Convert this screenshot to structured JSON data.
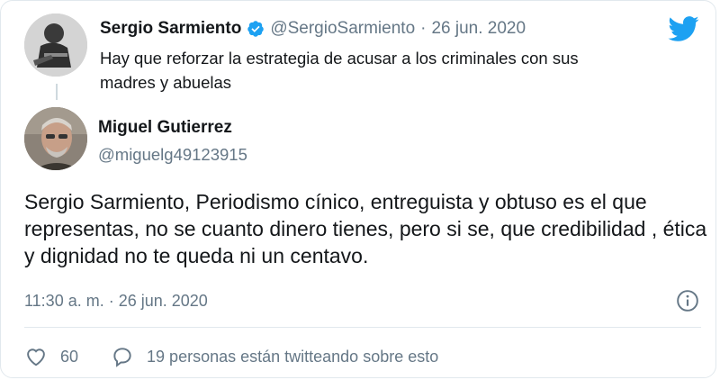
{
  "quoted_tweet": {
    "name": "Sergio Sarmiento",
    "handle": "@SergioSarmiento",
    "separator": "·",
    "date": "26 jun. 2020",
    "text": "Hay que reforzar la estrategia de acusar a los criminales con sus madres y abuelas",
    "verified_icon": "verified-badge-icon",
    "verified_color": "#1da1f2"
  },
  "brand": {
    "logo_icon": "twitter-bird-icon",
    "color": "#1da1f2"
  },
  "main_tweet": {
    "name": "Miguel Gutierrez",
    "handle": "@miguelg49123915",
    "text": "Sergio Sarmiento, Periodismo cínico, entreguista y obtuso es el que representas, no se cuanto dinero tienes, pero si se, que credibilidad , ética y dignidad no te queda ni un centavo.",
    "timestamp": "11:30 a. m. · 26 jun. 2020",
    "info_icon": "info-icon"
  },
  "actions": {
    "like_icon": "heart-icon",
    "like_count": "60",
    "reply_icon": "speech-bubble-icon",
    "reply_text": "19 personas están twitteando sobre esto"
  },
  "colors": {
    "text_primary": "#14171a",
    "text_secondary": "#657786",
    "border": "#e1e8ed"
  }
}
